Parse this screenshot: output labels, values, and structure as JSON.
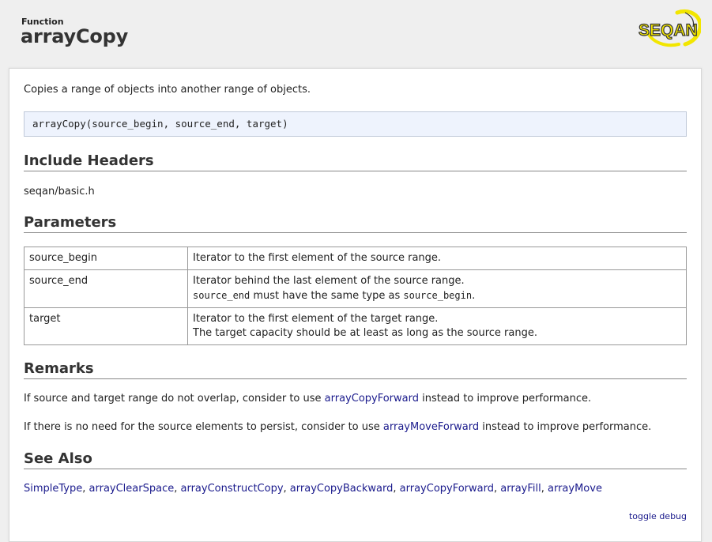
{
  "header": {
    "kind": "Function",
    "title": "arrayCopy",
    "logo_text": "SEQAN"
  },
  "summary": "Copies a range of objects into another range of objects.",
  "signature": "arrayCopy(source_begin, source_end, target)",
  "include": {
    "heading": "Include Headers",
    "file": "seqan/basic.h"
  },
  "parameters": {
    "heading": "Parameters",
    "rows": [
      {
        "name": "source_begin",
        "desc": "Iterator to the first element of the source range."
      },
      {
        "name": "source_end",
        "desc": "Iterator behind the last element of the source range.",
        "note_code1": "source_end",
        "note_text": " must have the same type as ",
        "note_code2": "source_begin",
        "note_end": "."
      },
      {
        "name": "target",
        "desc": "Iterator to the first element of the target range.",
        "desc2": "The target capacity should be at least as long as the source range."
      }
    ]
  },
  "remarks": {
    "heading": "Remarks",
    "r1_pre": "If source and target range do not overlap, consider to use ",
    "r1_link": "arrayCopyForward",
    "r1_post": " instead to improve performance.",
    "r2_pre": "If there is no need for the source elements to persist, consider to use ",
    "r2_link": "arrayMoveForward",
    "r2_post": " instead to improve performance."
  },
  "see_also": {
    "heading": "See Also",
    "links": [
      "SimpleType",
      "arrayClearSpace",
      "arrayConstructCopy",
      "arrayCopyBackward",
      "arrayCopyForward",
      "arrayFill",
      "arrayMove"
    ],
    "separator": ", "
  },
  "toggle_debug": "toggle debug",
  "colors": {
    "link": "#1a1a8c",
    "logo_yellow": "#f2e600",
    "signature_bg": "#eef3fd"
  }
}
